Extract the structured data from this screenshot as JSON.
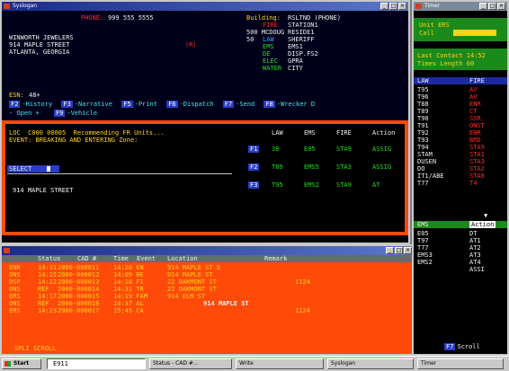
{
  "main_window": {
    "title": "Syslogan"
  },
  "top_panel": {
    "phone_label": "PHONE:",
    "phone_value": "999 555 5555",
    "business": "WINWORTH JEWELERS",
    "address": "914 MAPLE STREET",
    "city_state": "ATLANTA, GEORGIA",
    "code": "(R)",
    "building_label": "Building:",
    "building_value": "RSLTND (PHONE)",
    "right_rows": [
      {
        "c1": "",
        "c2": "FIRE",
        "c3": "STATION1"
      },
      {
        "c1": "500 MCDOUG",
        "c2": "",
        "c3": "RESIDE1"
      },
      {
        "c1": "50",
        "c2": "LAW",
        "c3": "SHERIFF"
      },
      {
        "c1": "",
        "c2": "EMS",
        "c3": "EMS1"
      },
      {
        "c1": "",
        "c2": "DE",
        "c3": "DISP.FS2"
      },
      {
        "c1": "",
        "c2": "ELEC",
        "c3": "GPRA"
      },
      {
        "c1": "",
        "c2": "WATER",
        "c3": "CITY"
      }
    ],
    "esn_label": "ESN:",
    "esn_value": "48+",
    "fkeys": [
      {
        "key": "F2",
        "label": "-History"
      },
      {
        "key": "F3",
        "label": "-Narrative"
      },
      {
        "key": "F5",
        "label": "-Print"
      },
      {
        "key": "F6",
        "label": "-Dispatch"
      },
      {
        "key": "F7",
        "label": "-Send"
      },
      {
        "key": "F8",
        "label": "-Wrecker D"
      }
    ],
    "fkeys2": [
      {
        "key": "",
        "label": "- Open +"
      },
      {
        "key": "F9",
        "label": "-Vehicle"
      }
    ]
  },
  "mid_panel": {
    "line1": "LOC  C000 00005  Recommending FR Units...",
    "line2": "EVENT: BREAKING AND ENTERING Zone:",
    "col_headers": [
      "LAW",
      "EMS",
      "FIRE",
      "Action"
    ],
    "unit_rows": [
      {
        "key": "F1",
        "law": "38",
        "ems": "E05",
        "fire": "STA9",
        "action": "ASSIG"
      },
      {
        "key": "F2",
        "law": "T89",
        "ems": "EMS5",
        "fire": "STA3",
        "action": "ASSIG"
      },
      {
        "key": "F3",
        "law": "T95",
        "ems": "EMS2",
        "fire": "STA9",
        "action": "AT"
      }
    ],
    "select_label": "SELECT",
    "address": "914 MAPLE STREET"
  },
  "bottom_panel": {
    "header": [
      "Status",
      "CAD #",
      "Time",
      "Event",
      "Location",
      "Remark"
    ],
    "rows": [
      {
        "status": "ENR",
        "time": "14:31",
        "cad": "2000-000011",
        "t2": "14:28 EN",
        "loc": "914 MAPLE ST S",
        "remark": ""
      },
      {
        "status": "ONS",
        "time": "14:15",
        "cad": "2000-000012",
        "t2": "14:09 BE",
        "loc": "914 MAPLE ST",
        "remark": ""
      },
      {
        "status": "DSP",
        "time": "14:22",
        "cad": "2000-000013",
        "t2": "14:18 FI",
        "loc": "22 OAKMONT ST",
        "remark": "1124"
      },
      {
        "status": "ONS",
        "time": "REF",
        "cad": "2000-000014",
        "t2": "14:31 TR",
        "loc": "22 OAKMONT ST",
        "remark": ""
      },
      {
        "status": "ERS",
        "time": "14:17",
        "cad": "2000-000015",
        "t2": "14:19 FAM",
        "loc": "914 ELM ST",
        "remark": ""
      },
      {
        "status": "ONS",
        "time": "REF",
        "cad": "2000-000016",
        "t2": "14:37 AL",
        "loc": "914 MAPLE ST",
        "remark": ""
      },
      {
        "status": "ERS",
        "time": "14:23",
        "cad": "2000-000017",
        "t2": "15:45 CA",
        "loc": "",
        "remark": "1124"
      }
    ],
    "footer": "SPLI SCROLL"
  },
  "side_window": {
    "title": "Timer",
    "call_label": "Call",
    "lines_top": [
      "Unit ERS",
      "Call"
    ],
    "last_label": "Last Contact 14:52",
    "time_label": "Times Length 00",
    "col_headers": [
      "LAW",
      "FIRE"
    ],
    "unit_rows": [
      {
        "u": "T95",
        "s": "AV"
      },
      {
        "u": "T96",
        "s": "AV"
      },
      {
        "u": "T88",
        "s": "ENR"
      },
      {
        "u": "T89",
        "s": "CT"
      },
      {
        "u": "T90",
        "s": "SSR"
      },
      {
        "u": "T91",
        "s": "ONST"
      },
      {
        "u": "T92",
        "s": "ENR"
      },
      {
        "u": "T93",
        "s": "BRD"
      },
      {
        "u": "T94",
        "s": "STA9"
      },
      {
        "u": "STAM",
        "s": "STA1"
      },
      {
        "u": "DUSEN",
        "s": "STA3"
      },
      {
        "u": "DO",
        "s": "STA2"
      },
      {
        "u": "IT1/ABE",
        "s": "STA8"
      },
      {
        "u": "T77",
        "s": "T4"
      }
    ],
    "ems_header": [
      "EMS",
      "Action"
    ],
    "ems_rows": [
      {
        "u": "E05",
        "s": "DT"
      },
      {
        "u": "T97",
        "s": "AT1"
      },
      {
        "u": "T77",
        "s": "AT2"
      },
      {
        "u": "EMS3",
        "s": "AT3"
      },
      {
        "u": "EMS2",
        "s": "AT4"
      },
      {
        "u": "",
        "s": "ASSI"
      }
    ],
    "footer_key": "F7",
    "footer_label": "Scroll"
  },
  "taskbar": {
    "start": "Start",
    "input": "E911",
    "tasks": [
      "Status - CAD #...",
      "Write",
      "Syslogan",
      "Timer"
    ]
  }
}
